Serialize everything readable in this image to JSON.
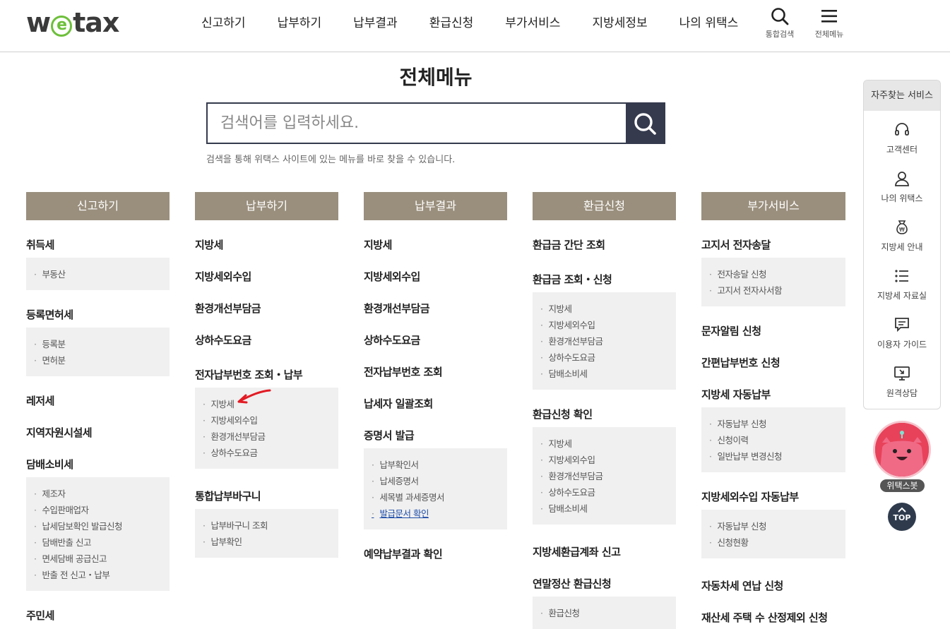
{
  "header": {
    "logo": "wetax",
    "gnb": [
      "신고하기",
      "납부하기",
      "납부결과",
      "환급신청",
      "부가서비스",
      "지방세정보",
      "나의 위택스"
    ],
    "search_label": "통합검색",
    "menu_label": "전체메뉴"
  },
  "page": {
    "title": "전체메뉴",
    "search_placeholder": "검색어를 입력하세요.",
    "hint": "검색을 통해 위택스 사이트에 있는 메뉴를 바로 찾을 수 있습니다."
  },
  "columns": [
    {
      "head": "신고하기",
      "groups": [
        {
          "title": "취득세",
          "subs": [
            "부동산"
          ]
        },
        {
          "title": "등록면허세",
          "subs": [
            "등록분",
            "면허분"
          ]
        },
        {
          "title": "레저세",
          "subs": []
        },
        {
          "title": "지역자원시설세",
          "subs": []
        },
        {
          "title": "담배소비세",
          "subs": [
            "제조자",
            "수입판매업자",
            "납세담보확인 발급신청",
            "담배반출 신고",
            "면세담배 공급신고",
            "반출 전 신고・납부"
          ]
        },
        {
          "title": "주민세",
          "subs": []
        }
      ]
    },
    {
      "head": "납부하기",
      "groups": [
        {
          "title": "지방세",
          "subs": []
        },
        {
          "title": "지방세외수입",
          "subs": []
        },
        {
          "title": "환경개선부담금",
          "subs": []
        },
        {
          "title": "상하수도요금",
          "subs": []
        },
        {
          "title": "전자납부번호 조회・납부",
          "subs": [
            "지방세",
            "지방세외수입",
            "환경개선부담금",
            "상하수도요금"
          ]
        },
        {
          "title": "통합납부바구니",
          "subs": [
            "납부바구니 조회",
            "납부확인"
          ]
        }
      ]
    },
    {
      "head": "납부결과",
      "groups": [
        {
          "title": "지방세",
          "subs": []
        },
        {
          "title": "지방세외수입",
          "subs": []
        },
        {
          "title": "환경개선부담금",
          "subs": []
        },
        {
          "title": "상하수도요금",
          "subs": []
        },
        {
          "title": "전자납부번호 조회",
          "subs": []
        },
        {
          "title": "납세자 일괄조회",
          "subs": []
        },
        {
          "title": "증명서 발급",
          "subs": [
            "납부확인서",
            "납세증명서",
            "세목별 과세증명서",
            "발급문서 확인"
          ]
        },
        {
          "title": "예약납부결과 확인",
          "subs": []
        }
      ]
    },
    {
      "head": "환급신청",
      "groups": [
        {
          "title": "환급금 간단 조회",
          "subs": []
        },
        {
          "title": "환급금 조회・신청",
          "subs": [
            "지방세",
            "지방세외수입",
            "환경개선부담금",
            "상하수도요금",
            "담배소비세"
          ]
        },
        {
          "title": "환급신청 확인",
          "subs": [
            "지방세",
            "지방세외수입",
            "환경개선부담금",
            "상하수도요금",
            "담배소비세"
          ]
        },
        {
          "title": "지방세환급계좌 신고",
          "subs": []
        },
        {
          "title": "연말정산 환급신청",
          "subs": [
            "환급신청"
          ]
        }
      ]
    },
    {
      "head": "부가서비스",
      "groups": [
        {
          "title": "고지서 전자송달",
          "subs": [
            "전자송달 신청",
            "고지서 전자사서함"
          ]
        },
        {
          "title": "문자알림 신청",
          "subs": []
        },
        {
          "title": "간편납부번호 신청",
          "subs": []
        },
        {
          "title": "지방세 자동납부",
          "subs": [
            "자동납부 신청",
            "신청이력",
            "일반납부 변경신청"
          ]
        },
        {
          "title": "지방세외수입 자동납부",
          "subs": [
            "자동납부 신청",
            "신청현황"
          ]
        },
        {
          "title": "자동차세 연납 신청",
          "subs": []
        },
        {
          "title": "재산세 주택 수 산정제외 신청",
          "subs": []
        }
      ]
    }
  ],
  "quick": {
    "head": "자주찾는 서비스",
    "items": [
      "고객센터",
      "나의 위택스",
      "지방세 안내",
      "지방세 자료실",
      "이용자 가이드",
      "원격상담"
    ]
  },
  "bot_label": "위택스봇",
  "top_label": "TOP"
}
